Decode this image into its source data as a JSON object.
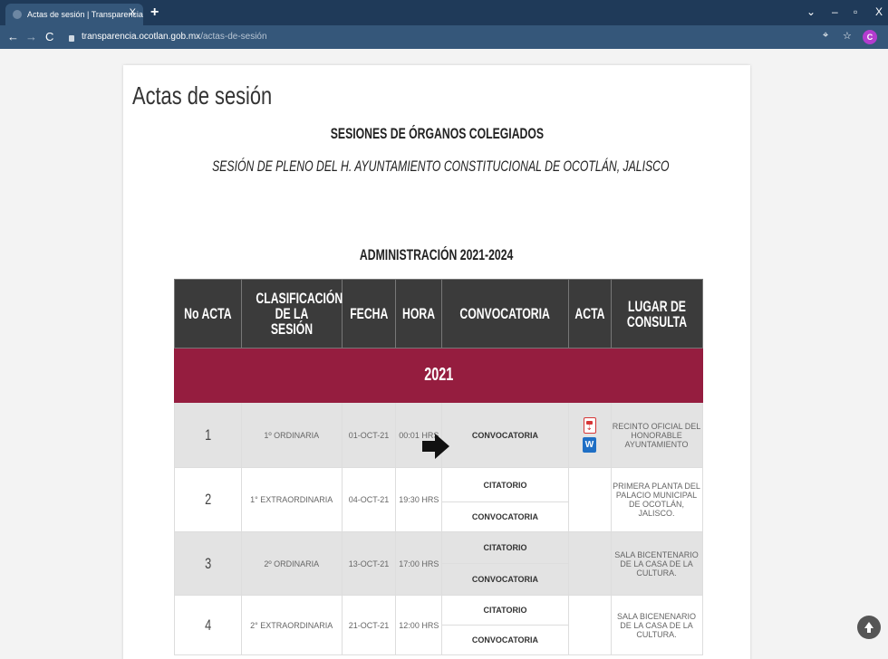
{
  "browser": {
    "tab_title": "Actas de sesión | Transparencia",
    "tab_close": "X",
    "new_tab": "+",
    "url_host": "transparencia.ocotlan.gob.mx",
    "url_path": "/actas-de-sesión",
    "profile_initial": "C",
    "window_controls": [
      "⌄",
      "–",
      "▫",
      "X"
    ]
  },
  "page": {
    "title": "Actas de sesión",
    "section_heading": "SESIONES DE ÓRGANOS COLEGIADOS",
    "session_subtitle": "SESIÓN DE PLENO DEL H. AYUNTAMIENTO CONSTITUCIONAL DE OCOTLÁN, JALISCO",
    "administration": "ADMINISTRACIÓN 2021-2024"
  },
  "table": {
    "headers": [
      "No ACTA",
      "CLASIFICACIÓN DE LA SESIÓN",
      "FECHA",
      "HORA",
      "CONVOCATORIA",
      "ACTA",
      "LUGAR DE CONSULTA"
    ],
    "year": "2021",
    "rows": [
      {
        "num": "1",
        "clasificacion": "1º ORDINARIA",
        "fecha": "01-OCT-21",
        "hora": "00:01 HRS",
        "docs": [
          "CONVOCATORIA"
        ],
        "lugar": "RECINTO OFICIAL DEL HONORABLE AYUNTAMIENTO"
      },
      {
        "num": "2",
        "clasificacion": "1° EXTRAORDINARIA",
        "fecha": "04-OCT-21",
        "hora": "19:30 HRS",
        "docs": [
          "CITATORIO",
          "CONVOCATORIA"
        ],
        "lugar": "PRIMERA PLANTA DEL PALACIO MUNICIPAL DE OCOTLÁN, JALISCO."
      },
      {
        "num": "3",
        "clasificacion": "2º ORDINARIA",
        "fecha": "13-OCT-21",
        "hora": "17:00 HRS",
        "docs": [
          "CITATORIO",
          "CONVOCATORIA"
        ],
        "lugar": "SALA BICENTENARIO DE LA CASA DE LA CULTURA."
      },
      {
        "num": "4",
        "clasificacion": "2° EXTRAORDINARIA",
        "fecha": "21-OCT-21",
        "hora": "12:00 HRS",
        "docs": [
          "CITATORIO",
          "CONVOCATORIA"
        ],
        "lugar": "SALA BICENENARIO DE LA CASA DE LA CULTURA."
      }
    ],
    "word_icon_letter": "W"
  }
}
